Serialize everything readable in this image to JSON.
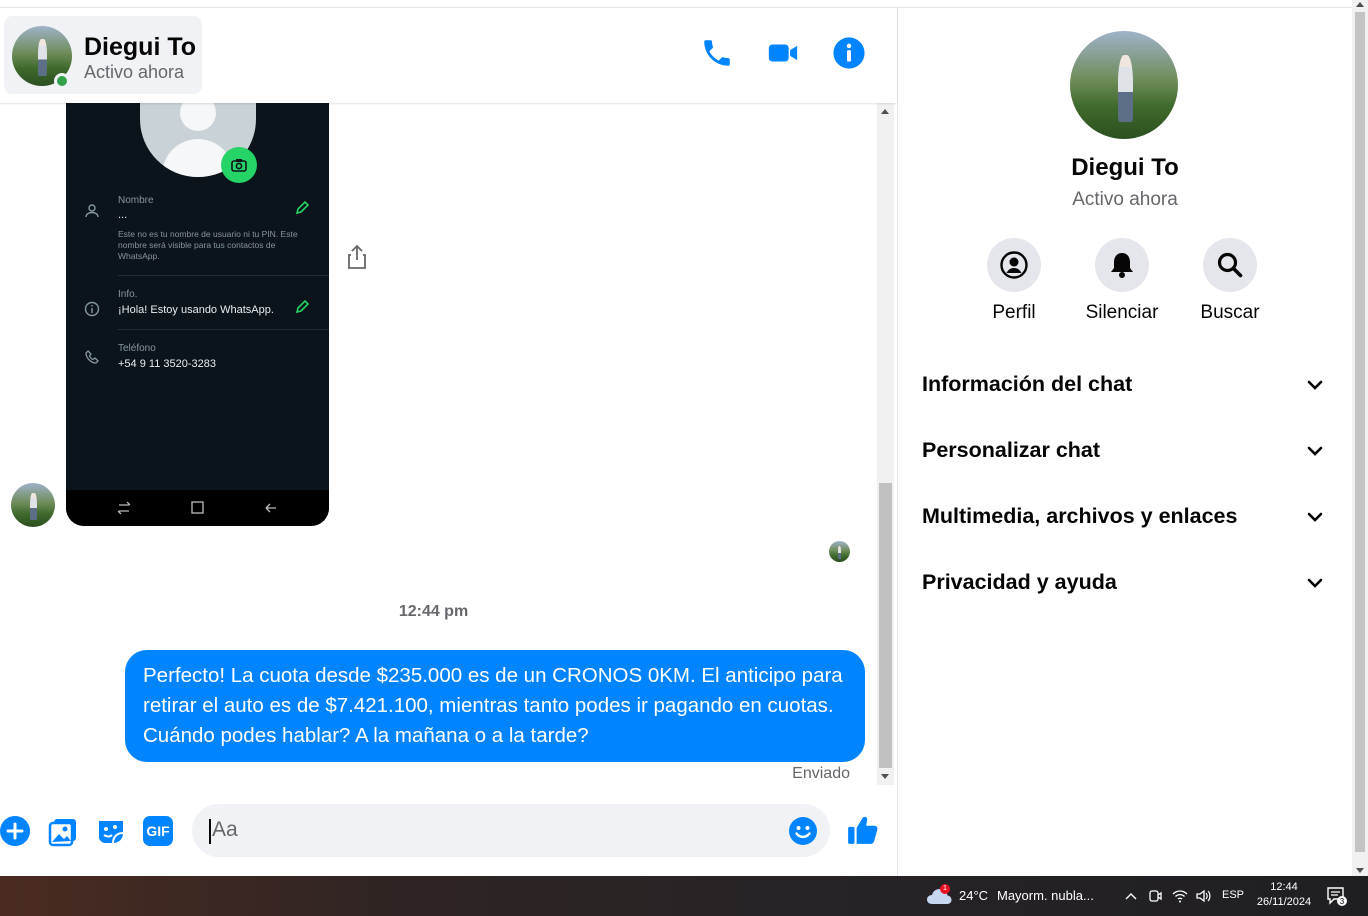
{
  "header": {
    "contact_name": "Diegui To",
    "contact_status": "Activo ahora",
    "icons": [
      "phone-icon",
      "video-icon",
      "info-icon"
    ]
  },
  "shared_image": {
    "name_label": "Nombre",
    "name_value": "...",
    "name_hint": "Este no es tu nombre de usuario ni tu PIN. Este nombre será visible para tus contactos de WhatsApp.",
    "info_label": "Info.",
    "info_value": "¡Hola! Estoy usando WhatsApp.",
    "phone_label": "Teléfono",
    "phone_value": "+54 9 11 3520-3283"
  },
  "messages": {
    "timestamp": "12:44 pm",
    "outgoing_text": "Perfecto! La cuota desde $235.000 es de un CRONOS 0KM. El anticipo para retirar el auto es de $7.421.100, mientras tanto podes ir pagando en cuotas. Cuándo podes hablar? A la mañana o a la tarde?",
    "status": "Enviado"
  },
  "composer": {
    "placeholder": "Aa",
    "icons": [
      "plus-icon",
      "image-icon",
      "sticker-icon",
      "gif-icon",
      "emoji-icon",
      "like-icon"
    ],
    "gif_label": "GIF"
  },
  "side_panel": {
    "name": "Diegui To",
    "status": "Activo ahora",
    "actions": [
      {
        "label": "Perfil",
        "icon": "profile-icon"
      },
      {
        "label": "Silenciar",
        "icon": "bell-icon"
      },
      {
        "label": "Buscar",
        "icon": "search-icon"
      }
    ],
    "sections": [
      "Información del chat",
      "Personalizar chat",
      "Multimedia, archivos y enlaces",
      "Privacidad y ayuda"
    ]
  },
  "taskbar": {
    "weather_temp": "24°C",
    "weather_text": "Mayorm. nubla...",
    "weather_badge": "1",
    "language": "ESP",
    "time": "12:44",
    "date": "26/11/2024",
    "notifications": "3"
  },
  "colors": {
    "accent": "#0084ff",
    "online": "#31a24c",
    "whatsapp_green": "#25d366"
  }
}
